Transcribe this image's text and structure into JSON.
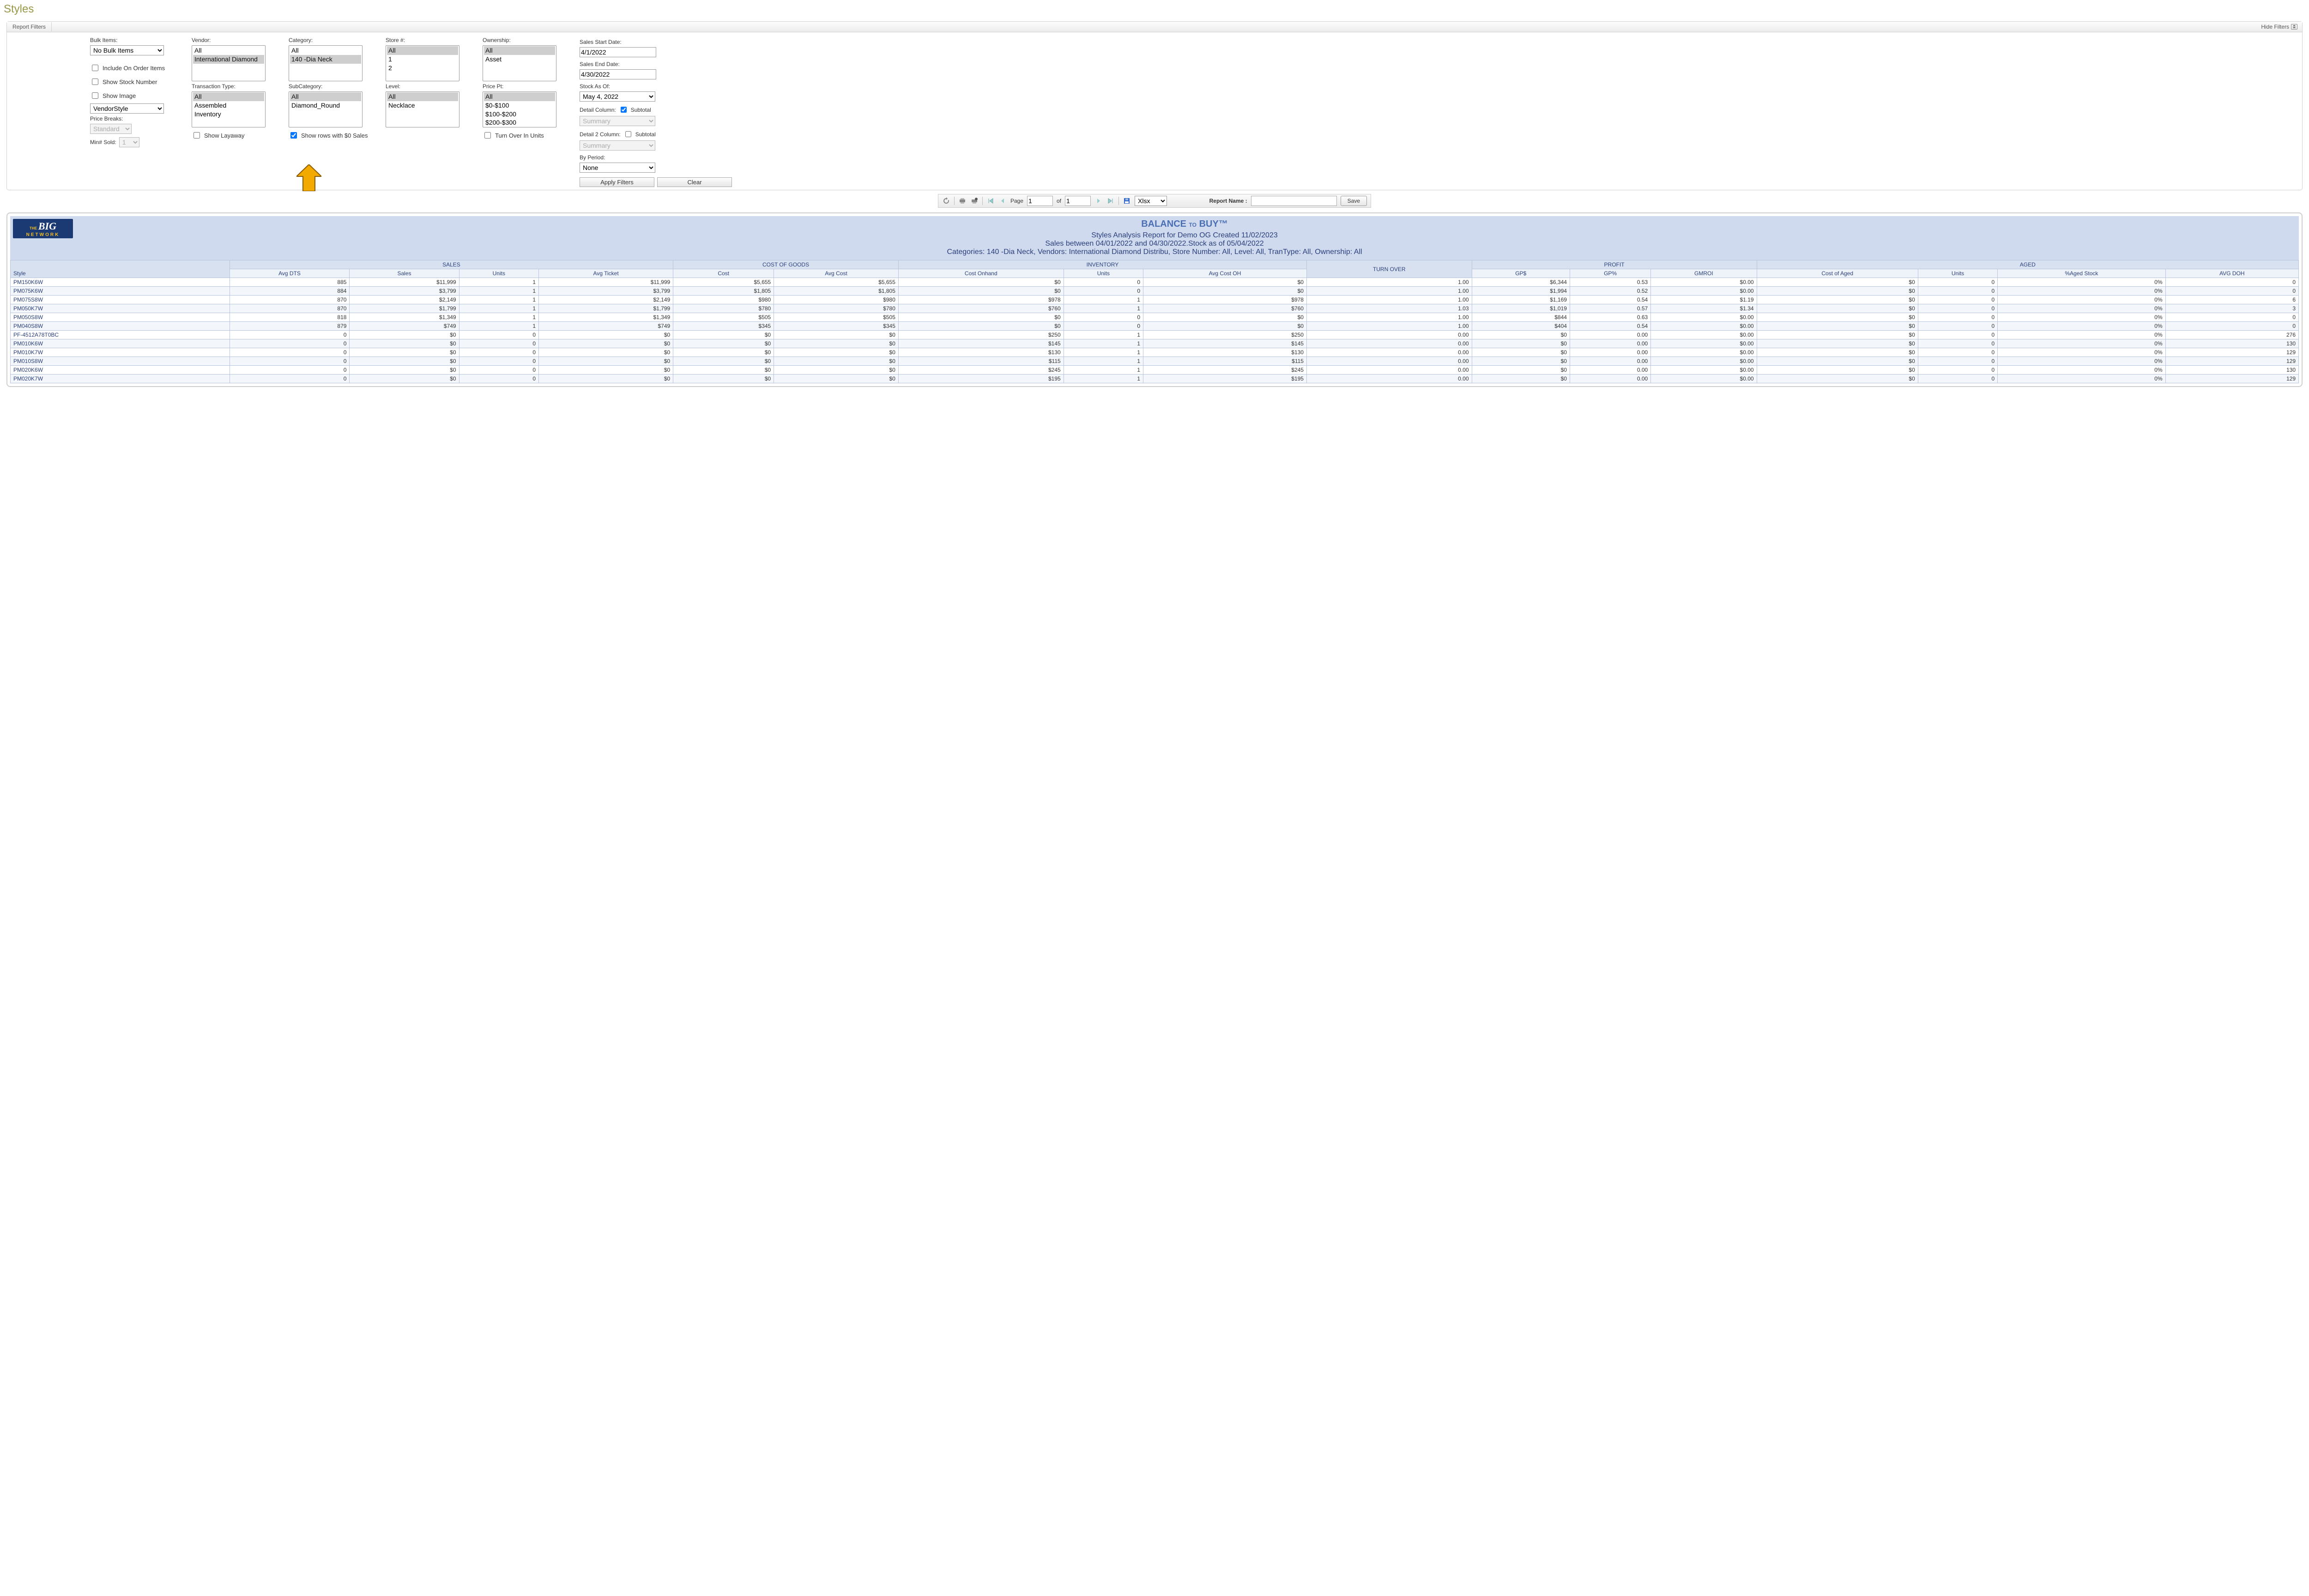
{
  "page_title": "Styles",
  "panel": {
    "tab": "Report Filters",
    "hide": "Hide Filters"
  },
  "bulk": {
    "label": "Bulk Items:",
    "value": "No Bulk Items",
    "include_on_order": "Include On Order Items",
    "show_stock_no": "Show Stock Number",
    "show_image": "Show Image",
    "style_select": "VendorStyle",
    "price_breaks_label": "Price Breaks:",
    "price_breaks_value": "Standard",
    "min_sold_label": "Min# Sold:",
    "min_sold_value": "1"
  },
  "vendor": {
    "label": "Vendor:",
    "opts": [
      "All",
      "International Diamond"
    ]
  },
  "trantype": {
    "label": "Transaction Type:",
    "opts": [
      "All",
      "Assembled",
      "Inventory"
    ],
    "show_layaway": "Show Layaway"
  },
  "category": {
    "label": "Category:",
    "opts": [
      "All",
      "140 -Dia Neck"
    ]
  },
  "subcat": {
    "label": "SubCategory:",
    "opts": [
      "All",
      "Diamond_Round"
    ],
    "show_zero": "Show rows with $0 Sales"
  },
  "store": {
    "label": "Store #:",
    "opts": [
      "All",
      "1",
      "2"
    ]
  },
  "level": {
    "label": "Level:",
    "opts": [
      "All",
      "Necklace"
    ]
  },
  "ownership": {
    "label": "Ownership:",
    "opts": [
      "All",
      "Asset"
    ]
  },
  "pricept": {
    "label": "Price Pt:",
    "opts": [
      "All",
      "$0-$100",
      "$100-$200",
      "$200-$300"
    ],
    "turnover": "Turn Over In Units"
  },
  "dates": {
    "start_label": "Sales Start Date:",
    "start": "4/1/2022",
    "end_label": "Sales End Date:",
    "end": "4/30/2022",
    "stock_label": "Stock As Of:",
    "stock": "May 4, 2022",
    "detail_label": "Detail Column:",
    "subtotal": "Subtotal",
    "detail_value": "Summary",
    "detail2_label": "Detail 2 Column:",
    "detail2_sub": "Subtotal",
    "detail2_value": "Summary",
    "byperiod_label": "By Period:",
    "byperiod": "None",
    "apply": "Apply Filters",
    "clear": "Clear"
  },
  "toolbar": {
    "page_label": "Page",
    "page": "1",
    "of": "of",
    "total": "1",
    "format": "Xlsx",
    "report_name_label": "Report Name :",
    "report_name": "",
    "save": "Save"
  },
  "report": {
    "b2b": "BALANCE",
    "to": "TO",
    "buy": "BUY™",
    "line1": "Styles Analysis Report for Demo OG Created 11/02/2023",
    "line2": "Sales between 04/01/2022 and 04/30/2022.Stock as of 05/04/2022",
    "line3": "Categories: 140 -Dia Neck, Vendors: International Diamond Distribu, Store Number: All, Level: All, TranType: All, Ownership: All",
    "groups": {
      "sales": "SALES",
      "cogs": "COST OF GOODS",
      "inv": "INVENTORY",
      "turn": "TURN OVER",
      "profit": "PROFIT",
      "aged": "AGED"
    },
    "cols": [
      "Style",
      "Avg DTS",
      "Sales",
      "Units",
      "Avg Ticket",
      "Cost",
      "Avg Cost",
      "Cost Onhand",
      "Units",
      "Avg Cost OH",
      "",
      "GP$",
      "GP%",
      "GMROI",
      "Cost of Aged",
      "Units",
      "%Aged Stock",
      "AVG DOH"
    ],
    "rows": [
      {
        "style": "PM150K6W",
        "avgdts": "885",
        "sales": "$11,999",
        "su": "1",
        "avgt": "$11,999",
        "cost": "$5,655",
        "avgc": "$5,655",
        "coh": "$0",
        "iu": "0",
        "acoh": "$0",
        "turn": "1.00",
        "gp": "$6,344",
        "gpp": "0.53",
        "gmroi": "$0.00",
        "ca": "$0",
        "au": "0",
        "pct": "0%",
        "doh": "0"
      },
      {
        "style": "PM075K6W",
        "avgdts": "884",
        "sales": "$3,799",
        "su": "1",
        "avgt": "$3,799",
        "cost": "$1,805",
        "avgc": "$1,805",
        "coh": "$0",
        "iu": "0",
        "acoh": "$0",
        "turn": "1.00",
        "gp": "$1,994",
        "gpp": "0.52",
        "gmroi": "$0.00",
        "ca": "$0",
        "au": "0",
        "pct": "0%",
        "doh": "0"
      },
      {
        "style": "PM075S8W",
        "avgdts": "870",
        "sales": "$2,149",
        "su": "1",
        "avgt": "$2,149",
        "cost": "$980",
        "avgc": "$980",
        "coh": "$978",
        "iu": "1",
        "acoh": "$978",
        "turn": "1.00",
        "gp": "$1,169",
        "gpp": "0.54",
        "gmroi": "$1.19",
        "ca": "$0",
        "au": "0",
        "pct": "0%",
        "doh": "6"
      },
      {
        "style": "PM050K7W",
        "avgdts": "870",
        "sales": "$1,799",
        "su": "1",
        "avgt": "$1,799",
        "cost": "$780",
        "avgc": "$780",
        "coh": "$760",
        "iu": "1",
        "acoh": "$760",
        "turn": "1.03",
        "gp": "$1,019",
        "gpp": "0.57",
        "gmroi": "$1.34",
        "ca": "$0",
        "au": "0",
        "pct": "0%",
        "doh": "3"
      },
      {
        "style": "PM050S8W",
        "avgdts": "818",
        "sales": "$1,349",
        "su": "1",
        "avgt": "$1,349",
        "cost": "$505",
        "avgc": "$505",
        "coh": "$0",
        "iu": "0",
        "acoh": "$0",
        "turn": "1.00",
        "gp": "$844",
        "gpp": "0.63",
        "gmroi": "$0.00",
        "ca": "$0",
        "au": "0",
        "pct": "0%",
        "doh": "0"
      },
      {
        "style": "PM040S8W",
        "avgdts": "879",
        "sales": "$749",
        "su": "1",
        "avgt": "$749",
        "cost": "$345",
        "avgc": "$345",
        "coh": "$0",
        "iu": "0",
        "acoh": "$0",
        "turn": "1.00",
        "gp": "$404",
        "gpp": "0.54",
        "gmroi": "$0.00",
        "ca": "$0",
        "au": "0",
        "pct": "0%",
        "doh": "0"
      },
      {
        "style": "PF-4512A78T0BC",
        "avgdts": "0",
        "sales": "$0",
        "su": "0",
        "avgt": "$0",
        "cost": "$0",
        "avgc": "$0",
        "coh": "$250",
        "iu": "1",
        "acoh": "$250",
        "turn": "0.00",
        "gp": "$0",
        "gpp": "0.00",
        "gmroi": "$0.00",
        "ca": "$0",
        "au": "0",
        "pct": "0%",
        "doh": "276"
      },
      {
        "style": "PM010K6W",
        "avgdts": "0",
        "sales": "$0",
        "su": "0",
        "avgt": "$0",
        "cost": "$0",
        "avgc": "$0",
        "coh": "$145",
        "iu": "1",
        "acoh": "$145",
        "turn": "0.00",
        "gp": "$0",
        "gpp": "0.00",
        "gmroi": "$0.00",
        "ca": "$0",
        "au": "0",
        "pct": "0%",
        "doh": "130"
      },
      {
        "style": "PM010K7W",
        "avgdts": "0",
        "sales": "$0",
        "su": "0",
        "avgt": "$0",
        "cost": "$0",
        "avgc": "$0",
        "coh": "$130",
        "iu": "1",
        "acoh": "$130",
        "turn": "0.00",
        "gp": "$0",
        "gpp": "0.00",
        "gmroi": "$0.00",
        "ca": "$0",
        "au": "0",
        "pct": "0%",
        "doh": "129"
      },
      {
        "style": "PM010S8W",
        "avgdts": "0",
        "sales": "$0",
        "su": "0",
        "avgt": "$0",
        "cost": "$0",
        "avgc": "$0",
        "coh": "$115",
        "iu": "1",
        "acoh": "$115",
        "turn": "0.00",
        "gp": "$0",
        "gpp": "0.00",
        "gmroi": "$0.00",
        "ca": "$0",
        "au": "0",
        "pct": "0%",
        "doh": "129"
      },
      {
        "style": "PM020K6W",
        "avgdts": "0",
        "sales": "$0",
        "su": "0",
        "avgt": "$0",
        "cost": "$0",
        "avgc": "$0",
        "coh": "$245",
        "iu": "1",
        "acoh": "$245",
        "turn": "0.00",
        "gp": "$0",
        "gpp": "0.00",
        "gmroi": "$0.00",
        "ca": "$0",
        "au": "0",
        "pct": "0%",
        "doh": "130"
      },
      {
        "style": "PM020K7W",
        "avgdts": "0",
        "sales": "$0",
        "su": "0",
        "avgt": "$0",
        "cost": "$0",
        "avgc": "$0",
        "coh": "$195",
        "iu": "1",
        "acoh": "$195",
        "turn": "0.00",
        "gp": "$0",
        "gpp": "0.00",
        "gmroi": "$0.00",
        "ca": "$0",
        "au": "0",
        "pct": "0%",
        "doh": "129"
      }
    ]
  }
}
